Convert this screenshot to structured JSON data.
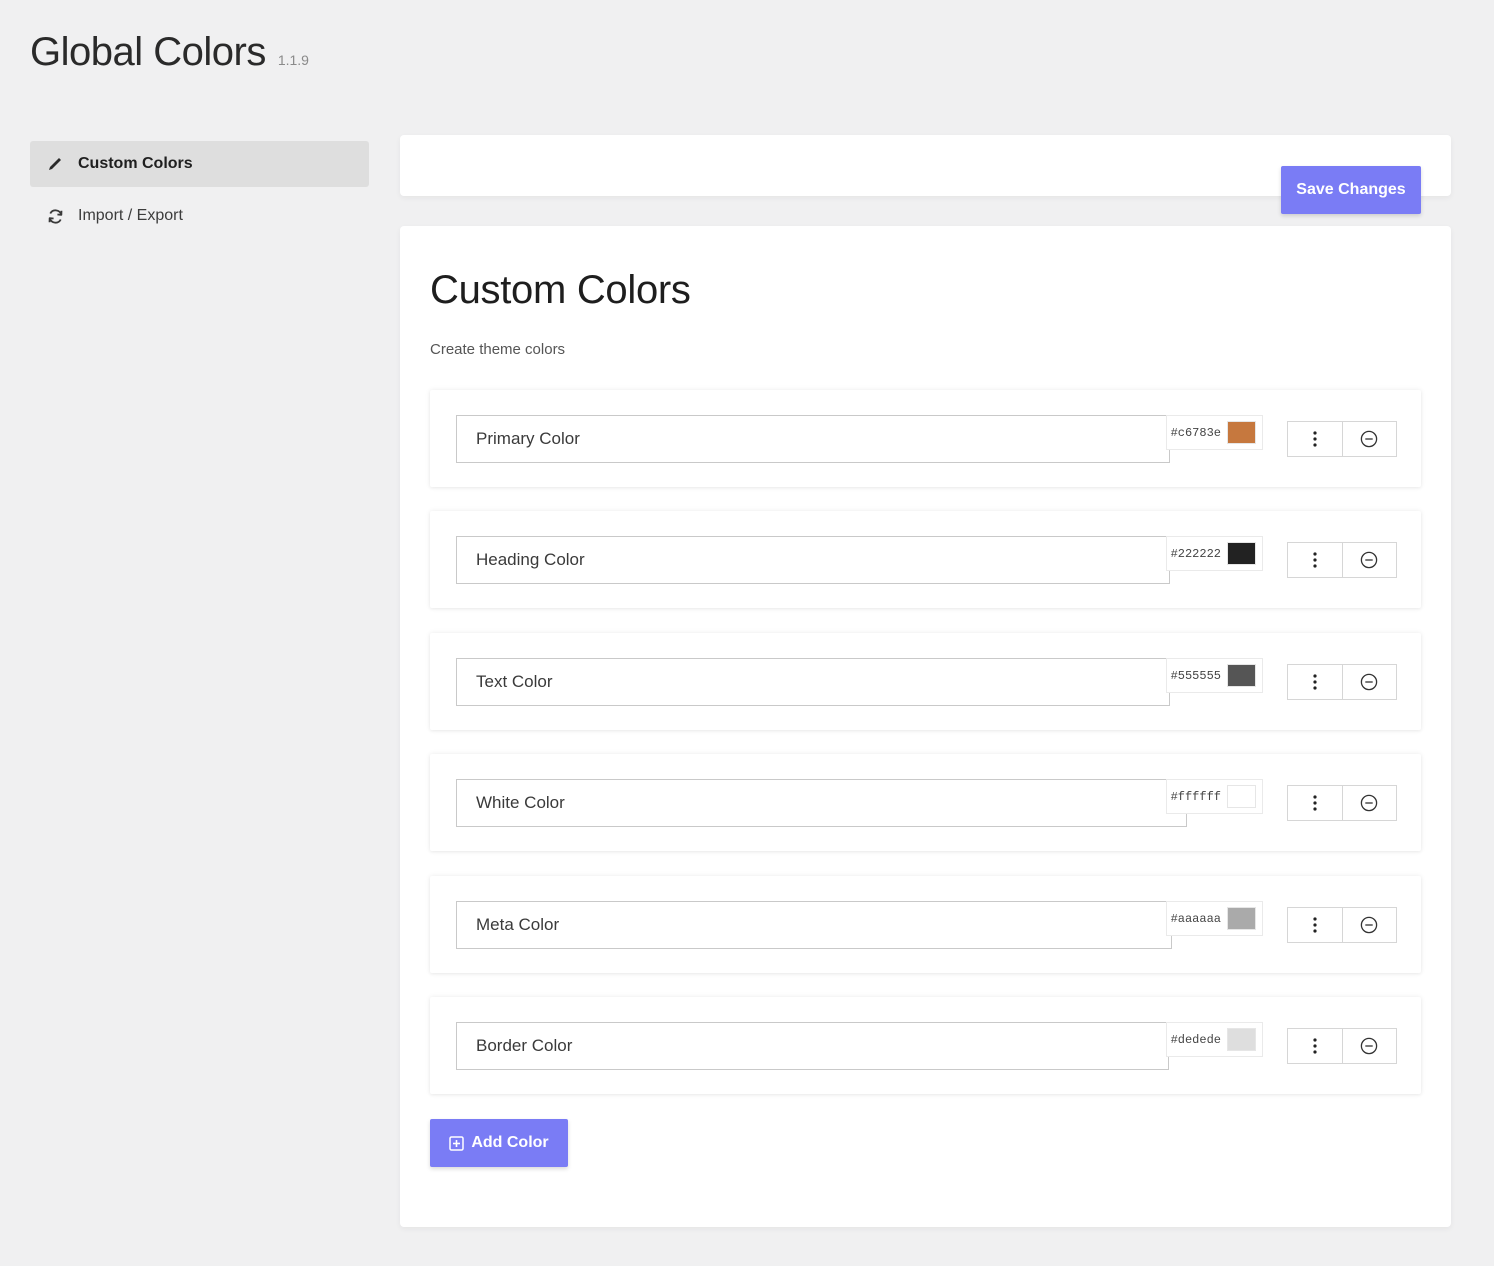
{
  "header": {
    "title": "Global Colors",
    "version": "1.1.9"
  },
  "sidebar": {
    "items": [
      {
        "label": "Custom Colors",
        "icon": "brush-icon"
      },
      {
        "label": "Import / Export",
        "icon": "sync-icon"
      }
    ]
  },
  "toolbar": {
    "save_label": "Save Changes"
  },
  "panel": {
    "title": "Custom Colors",
    "description": "Create theme colors"
  },
  "colors": [
    {
      "name": "Primary Color",
      "hex": "#c6783e"
    },
    {
      "name": "Heading Color",
      "hex": "#222222"
    },
    {
      "name": "Text Color",
      "hex": "#555555"
    },
    {
      "name": "White Color",
      "hex": "#ffffff"
    },
    {
      "name": "Meta Color",
      "hex": "#aaaaaa"
    },
    {
      "name": "Border Color",
      "hex": "#dedede"
    }
  ],
  "add_button": {
    "label": "Add Color"
  },
  "theme": {
    "accent": "#7a7cf5",
    "background": "#f0f0f1"
  }
}
